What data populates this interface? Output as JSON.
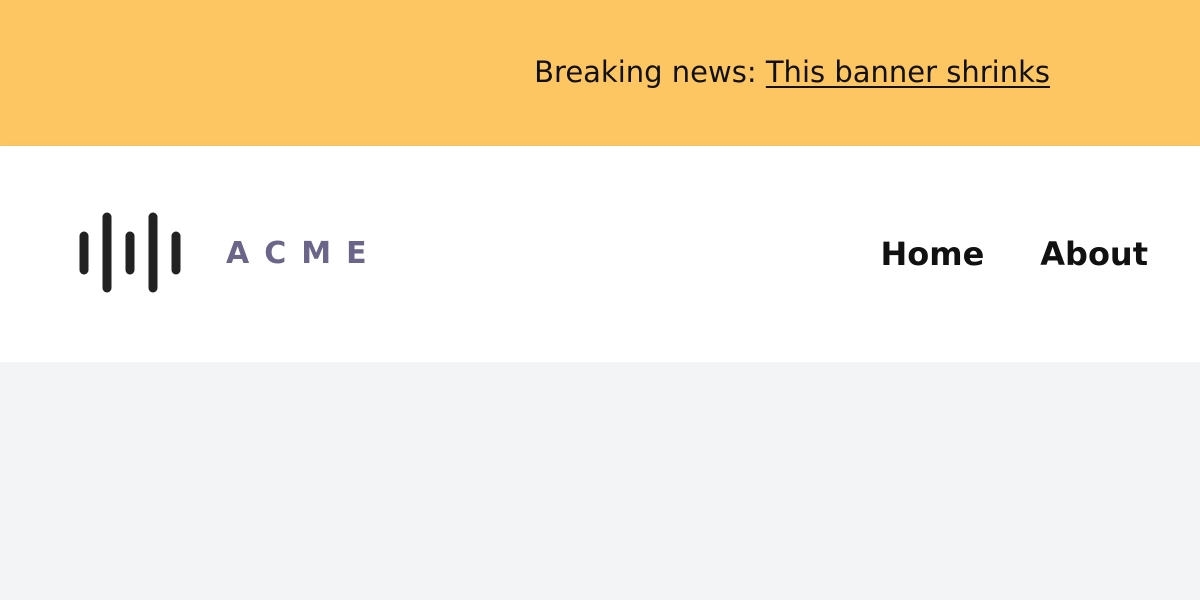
{
  "banner": {
    "prefix": "Breaking news: ",
    "link_text": "This banner shrinks"
  },
  "header": {
    "logo": {
      "icon": "sound-wave-bars-icon",
      "wordmark": "ACME",
      "wordmark_color": "#6b6589",
      "mark_color": "#222222"
    },
    "nav": {
      "items": [
        {
          "label": "Home"
        },
        {
          "label": "About"
        }
      ]
    }
  },
  "colors": {
    "banner_background": "#fdc663",
    "header_background": "#ffffff",
    "page_background": "#f3f4f6",
    "text": "#111111"
  }
}
